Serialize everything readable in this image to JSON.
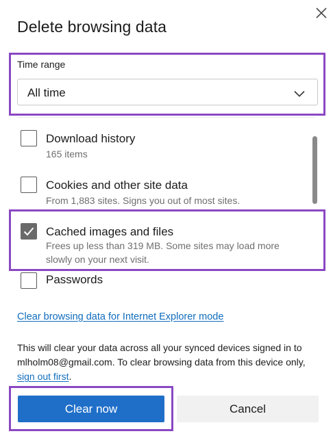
{
  "dialog": {
    "title": "Delete browsing data"
  },
  "time_range": {
    "label": "Time range",
    "selected": "All time"
  },
  "items": [
    {
      "title": "Download history",
      "subtitle": "165 items",
      "checked": false
    },
    {
      "title": "Cookies and other site data",
      "subtitle": "From 1,883 sites. Signs you out of most sites.",
      "checked": false
    },
    {
      "title": "Cached images and files",
      "subtitle": "Frees up less than 319 MB. Some sites may load more slowly on your next visit.",
      "checked": true
    },
    {
      "title": "Passwords",
      "subtitle": "",
      "checked": false
    }
  ],
  "ie_link": "Clear browsing data for Internet Explorer mode",
  "note": {
    "text": "This will clear your data across all your synced devices signed in to mlholm08@gmail.com. To clear browsing data from this device only,",
    "link": "sign out first",
    "suffix": "."
  },
  "buttons": {
    "clear": "Clear now",
    "cancel": "Cancel"
  },
  "colors": {
    "accent": "#1f6fc9",
    "link": "#0f6cbd",
    "highlight": "#8a47c2"
  },
  "icons": {
    "close": "close-icon",
    "dropdown": "chevron-down-icon",
    "check": "checkmark-icon"
  }
}
